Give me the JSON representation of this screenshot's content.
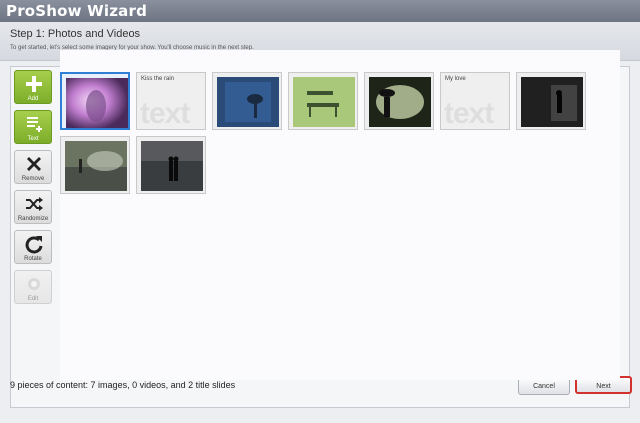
{
  "window": {
    "title": "ProShow Wizard"
  },
  "header": {
    "step_title": "Step 1: Photos and Videos",
    "description": "To get started, let's select some imagery for your show. You'll choose music in the next step."
  },
  "toolbar": {
    "add": "Add",
    "text": "Text",
    "remove": "Remove",
    "randomize": "Randomize",
    "rotate": "Rotate",
    "edit": "Edit"
  },
  "slides": [
    {
      "type": "image",
      "selected": true
    },
    {
      "type": "title",
      "title": "Kiss the rain",
      "watermark": "text"
    },
    {
      "type": "image"
    },
    {
      "type": "image"
    },
    {
      "type": "image"
    },
    {
      "type": "title",
      "title": "My love",
      "watermark": "text"
    },
    {
      "type": "image"
    },
    {
      "type": "image"
    },
    {
      "type": "image"
    }
  ],
  "footer": {
    "summary": "9 pieces of content: 7 images, 0 videos, and 2 title slides",
    "cancel": "Cancel",
    "next": "Next"
  },
  "colors": {
    "accent_green": "#7cad29",
    "selection_blue": "#2f7fd6",
    "next_highlight": "#d3312e"
  }
}
